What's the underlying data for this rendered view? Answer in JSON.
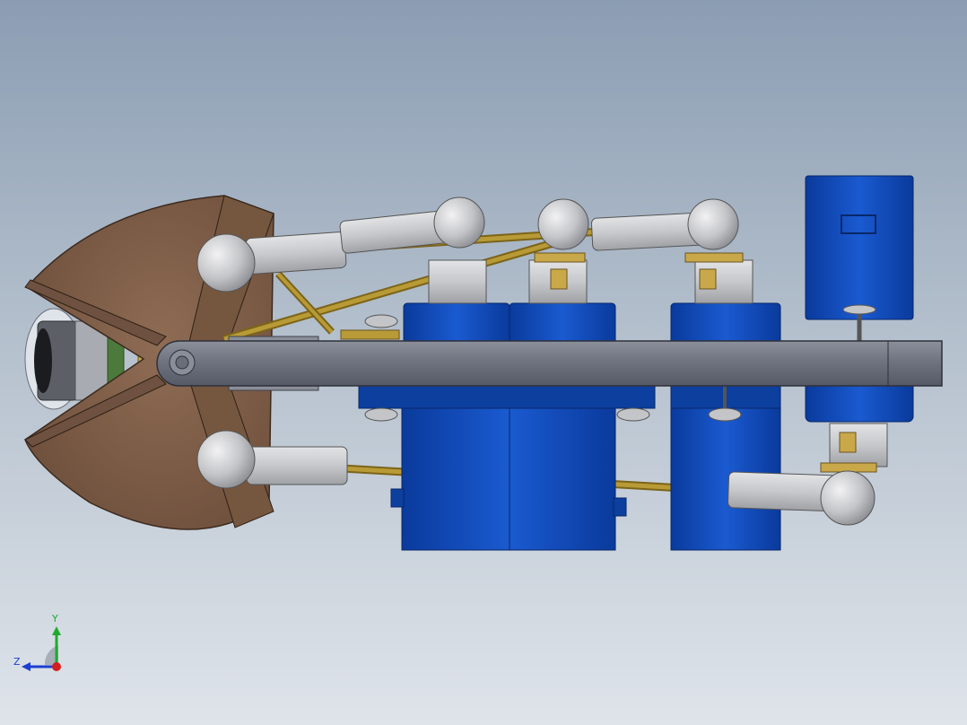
{
  "view": {
    "triad": {
      "y_label": "Y",
      "z_label": "Z",
      "y_color": "#1faa2d",
      "z_color": "#1c3fd0",
      "x_color": "#d21f1f"
    },
    "model": {
      "background_top": "#8b9db3",
      "background_bottom": "#dfe4ea",
      "servo_color": "#0f48b4",
      "arm_color": "#6a6f7c",
      "rod_color": "#a88a2a",
      "joint_color": "#c9cacc",
      "claw_color": "#7a5a44"
    }
  }
}
